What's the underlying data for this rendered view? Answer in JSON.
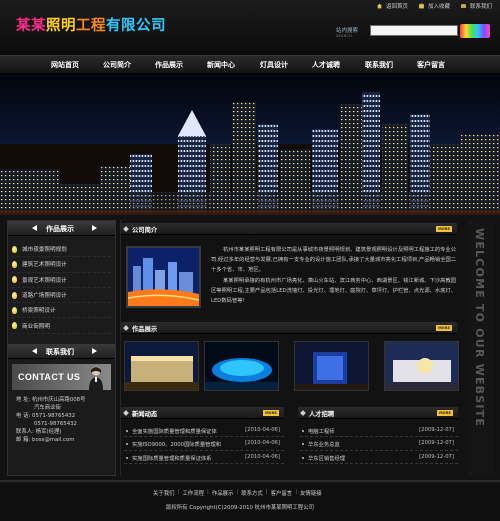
{
  "header": {
    "logo": [
      "某某",
      "照明",
      "工程",
      "有限公司"
    ],
    "top_links": [
      {
        "label": "返回首页",
        "icon": "home-icon"
      },
      {
        "label": "加入收藏",
        "icon": "favorite-icon"
      },
      {
        "label": "联系我们",
        "icon": "mail-icon"
      }
    ],
    "search": {
      "label": "站内搜索",
      "sub_label": "SEARCH",
      "value": ""
    }
  },
  "nav": [
    "网站首页",
    "公司简介",
    "作品展示",
    "新闻中心",
    "灯具设计",
    "人才诚聘",
    "联系我们",
    "客户留言"
  ],
  "sidebar": {
    "products_title": "作品展示",
    "categories": [
      "城市夜景照明规划",
      "建筑艺术照明设计",
      "景观艺术照明设计",
      "道路广场照明设计",
      "桥梁照明设计",
      "商业街照明"
    ],
    "contact_title": "联系我们",
    "contact_banner": "CONTACT US",
    "contact_lines": [
      "地  址: 杭州市庆山高路008号",
      "　　　  汽车商业街",
      "电  话: 0571-98765432",
      "　　　  0571-98765432",
      "联系人: 杨军(经理)",
      "邮  箱: boss@mail.com"
    ]
  },
  "about": {
    "title": "公司简介",
    "more": "MORE",
    "paragraphs": [
      "杭州市某某照明工程有限公司是从事城市夜景照明规划、建筑景观照明设计及照明工程施工的专业公司,经过多年的经营与发展,已拥有一支专业的设计施工团队,承接了大量城市亮化工程项目,产品畅销全国二十多个省、市、地区。",
      "某某照明承接的有杭州市广场亮化、萧山火车站、滨江商务中心、西湖景区、钱江新城、下沙高教园区等照明工程,主要产品包括LED洗墙灯、投光灯、埋地灯、庭院灯、草坪灯、护栏管、点光源、水底灯、LED数码管等!"
    ]
  },
  "products": {
    "title": "作品展示",
    "more": "MORE"
  },
  "news": {
    "title": "新闻动态",
    "more": "MORE",
    "items": [
      {
        "title": "全面实施国际质量管理和质量保证体",
        "date": "[2010-04-06]"
      },
      {
        "title": "实施ISO9000、2000国际质量管理和",
        "date": "[2010-04-06]"
      },
      {
        "title": "实施国际质量管理和质量保证体系",
        "date": "[2010-04-06]"
      }
    ]
  },
  "jobs": {
    "title": "人才招聘",
    "more": "MORE",
    "items": [
      {
        "title": "电脑工程师",
        "date": "[2009-12-07]"
      },
      {
        "title": "华东业务总监",
        "date": "[2009-12-07]"
      },
      {
        "title": "华东区销售经理",
        "date": "[2009-12-07]"
      }
    ]
  },
  "side_vertical_text": "WELCOME TO OUR WEBSITE",
  "footer": {
    "links": [
      "关于我们",
      "工作流程",
      "作品展示",
      "联系方式",
      "客户留言",
      "友情链接"
    ],
    "copyright": "版权所有 Copyright(C)2009-2010 杭州市某某照明工程公司"
  },
  "colors": {
    "logo_pink": "#ff2a8a",
    "logo_yellow": "#ffd21e",
    "logo_orange": "#ff8a1e",
    "logo_blue": "#31c7ff",
    "more_button": "#f0c040",
    "background": "#121212"
  }
}
